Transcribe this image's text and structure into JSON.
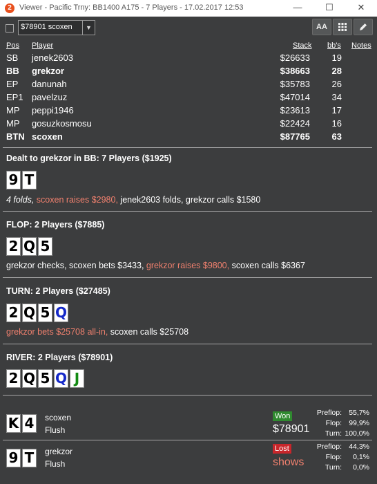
{
  "window": {
    "title": "Viewer - Pacific Trny: BB1400 A175 - 7 Players - 17.02.2017 12:53",
    "app_icon": "2",
    "minimize": "—",
    "maximize": "☐",
    "close": "✕"
  },
  "toolbar": {
    "hand_select": "$78901 scoxen",
    "font_button": "AA",
    "grid_button": "grid-icon",
    "edit_button": "pencil-icon"
  },
  "table": {
    "headers": {
      "pos": "Pos",
      "player": "Player",
      "stack": "Stack",
      "bbs": "bb's",
      "notes": "Notes"
    },
    "rows": [
      {
        "pos": "SB",
        "player": "jenek2603",
        "stack": "$26633",
        "bbs": "19",
        "bold": false
      },
      {
        "pos": "BB",
        "player": "grekzor",
        "stack": "$38663",
        "bbs": "28",
        "bold": true
      },
      {
        "pos": "EP",
        "player": "danunah",
        "stack": "$35783",
        "bbs": "26",
        "bold": false
      },
      {
        "pos": "EP1",
        "player": "pavelzuz",
        "stack": "$47014",
        "bbs": "34",
        "bold": false
      },
      {
        "pos": "MP",
        "player": "peppi1946",
        "stack": "$23613",
        "bbs": "17",
        "bold": false
      },
      {
        "pos": "MP",
        "player": "gosuzkosmosu",
        "stack": "$22424",
        "bbs": "16",
        "bold": false
      },
      {
        "pos": "BTN",
        "player": "scoxen",
        "stack": "$87765",
        "bbs": "63",
        "bold": true
      }
    ]
  },
  "preflop": {
    "title": "Dealt to grekzor in BB: 7 Players ($1925)",
    "cards": [
      "9",
      "T"
    ],
    "action_fold": "4 folds,",
    "action_raise": "scoxen raises $2980,",
    "action_rest": "jenek2603 folds, grekzor calls $1580"
  },
  "flop": {
    "title": "FLOP: 2 Players ($7885)",
    "cards": [
      "2",
      "Q",
      "5"
    ],
    "action_pre": "grekzor checks, scoxen bets $3433,",
    "action_raise": "grekzor raises $9800,",
    "action_post": "scoxen calls $6367"
  },
  "turn": {
    "title": "TURN: 2 Players ($27485)",
    "cards": [
      "2",
      "Q",
      "5",
      "Q"
    ],
    "action_raise": "grekzor bets $25708 all-in,",
    "action_post": "scoxen calls $25708"
  },
  "river": {
    "title": "RIVER: 2 Players ($78901)",
    "cards": [
      "2",
      "Q",
      "5",
      "Q",
      "J"
    ]
  },
  "showdown": [
    {
      "cards": [
        "K",
        "4"
      ],
      "player": "scoxen",
      "hand": "Flush",
      "result": "Won",
      "amount": "$78901",
      "eq_labels": [
        "Preflop:",
        "Flop:",
        "Turn:"
      ],
      "eq_values": [
        "55,7%",
        "99,9%",
        "100,0%"
      ]
    },
    {
      "cards": [
        "9",
        "T"
      ],
      "player": "grekzor",
      "hand": "Flush",
      "result": "Lost",
      "amount": "shows",
      "eq_labels": [
        "Preflop:",
        "Flop:",
        "Turn:"
      ],
      "eq_values": [
        "44,3%",
        "0,1%",
        "0,0%"
      ]
    }
  ],
  "colors": {
    "background": "#3c3d3e",
    "raise_text": "#f0806e",
    "won_badge": "#2f8a2f",
    "lost_badge": "#c8262b",
    "blue_suit": "#1428c8",
    "green_suit": "#128a12"
  }
}
